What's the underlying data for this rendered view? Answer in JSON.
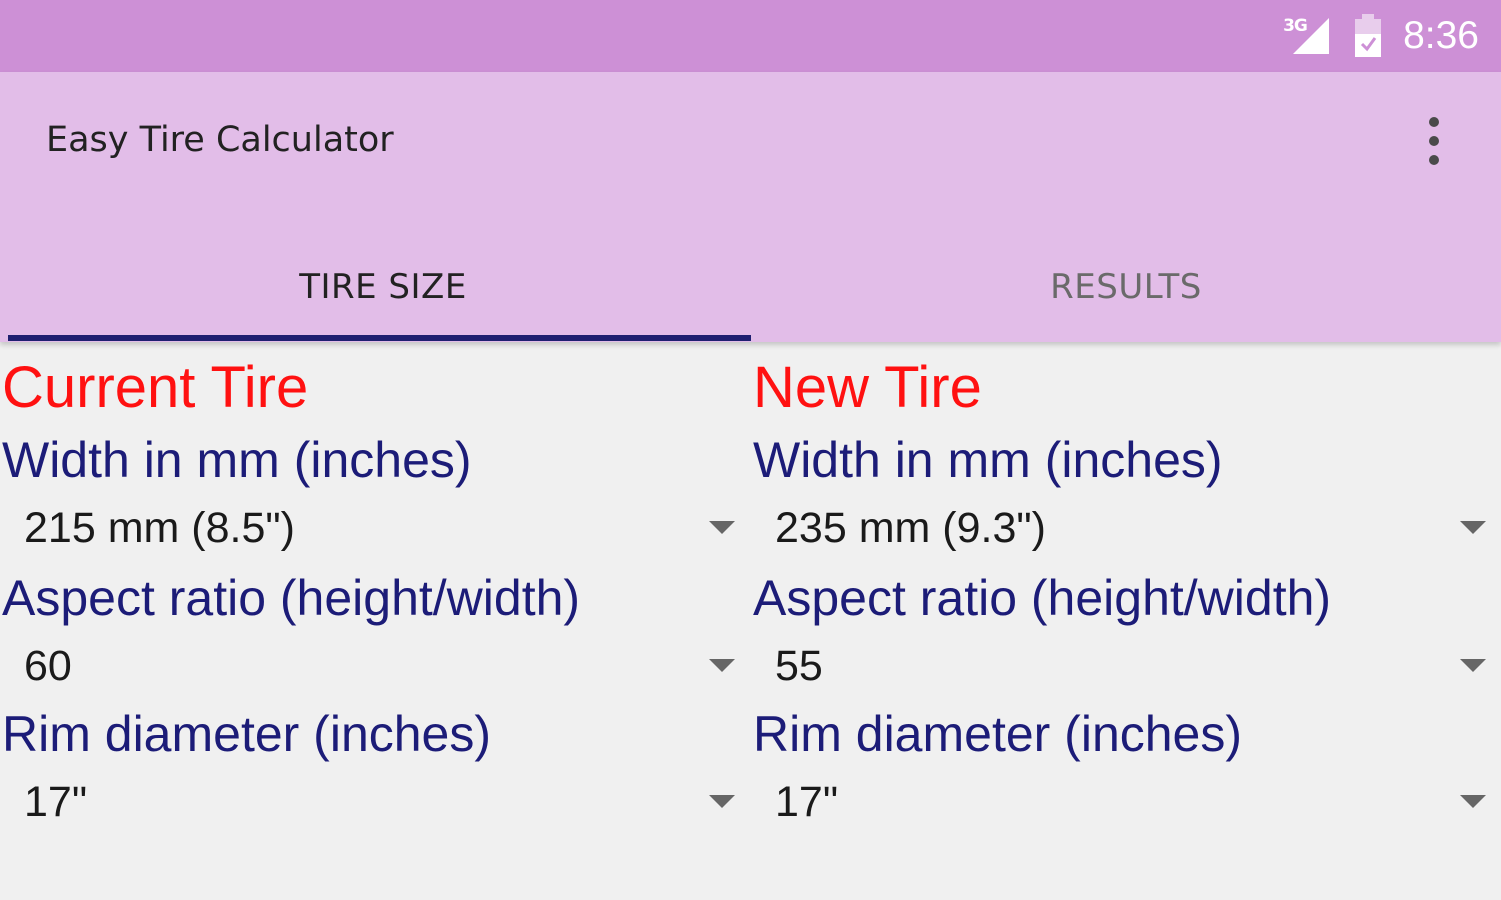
{
  "status_bar": {
    "network": "3G",
    "time": "8:36",
    "icons": [
      "signal-icon",
      "battery-icon"
    ]
  },
  "app_bar": {
    "title": "Easy Tire Calculator",
    "menu_icon": "more-vert-icon"
  },
  "tabs": [
    {
      "label": "TIRE SIZE",
      "selected": true
    },
    {
      "label": "RESULTS",
      "selected": false
    }
  ],
  "current_tire": {
    "heading": "Current Tire",
    "width_label": "Width in mm (inches)",
    "width_value": "215 mm (8.5\")",
    "aspect_label": "Aspect ratio (height/width)",
    "aspect_value": "60",
    "rim_label": "Rim diameter (inches)",
    "rim_value": "17\""
  },
  "new_tire": {
    "heading": "New Tire",
    "width_label": "Width in mm (inches)",
    "width_value": "235 mm (9.3\")",
    "aspect_label": "Aspect ratio (height/width)",
    "aspect_value": "55",
    "rim_label": "Rim diameter (inches)",
    "rim_value": "17\""
  },
  "colors": {
    "status_bar": "#cd90d6",
    "app_bar": "#e2bde8",
    "tab_indicator": "#1f1f70",
    "heading": "#ff1111",
    "label": "#1c1c78",
    "background": "#f0f0f0"
  }
}
